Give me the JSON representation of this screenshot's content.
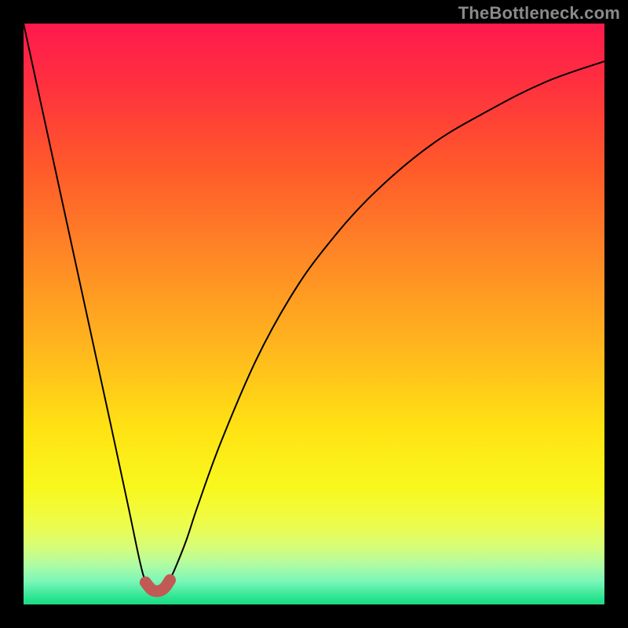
{
  "watermark": "TheBottleneck.com",
  "chart_data": {
    "type": "line",
    "title": "",
    "xlabel": "",
    "ylabel": "",
    "xlim": [
      0,
      100
    ],
    "ylim": [
      0,
      100
    ],
    "series": [
      {
        "name": "bottleneck-curve",
        "x": [
          0,
          5,
          10,
          15,
          18,
          20,
          21,
          22,
          23,
          24,
          25,
          26,
          28,
          30,
          34,
          40,
          46,
          52,
          60,
          70,
          80,
          90,
          100
        ],
        "values": [
          100,
          77,
          54,
          31,
          17,
          7.5,
          4,
          2.5,
          2.2,
          2.5,
          4,
          6,
          11,
          17,
          28,
          42,
          53,
          61.5,
          70.5,
          79,
          85,
          90,
          93.5
        ]
      }
    ],
    "marker": {
      "name": "optimal-region",
      "x": [
        21.0,
        22.0,
        22.8,
        23.6,
        24.4,
        25.2
      ],
      "values": [
        3.8,
        2.6,
        2.3,
        2.4,
        3.0,
        4.2
      ]
    },
    "gradient_description": "red-top-to-green-bottom"
  }
}
